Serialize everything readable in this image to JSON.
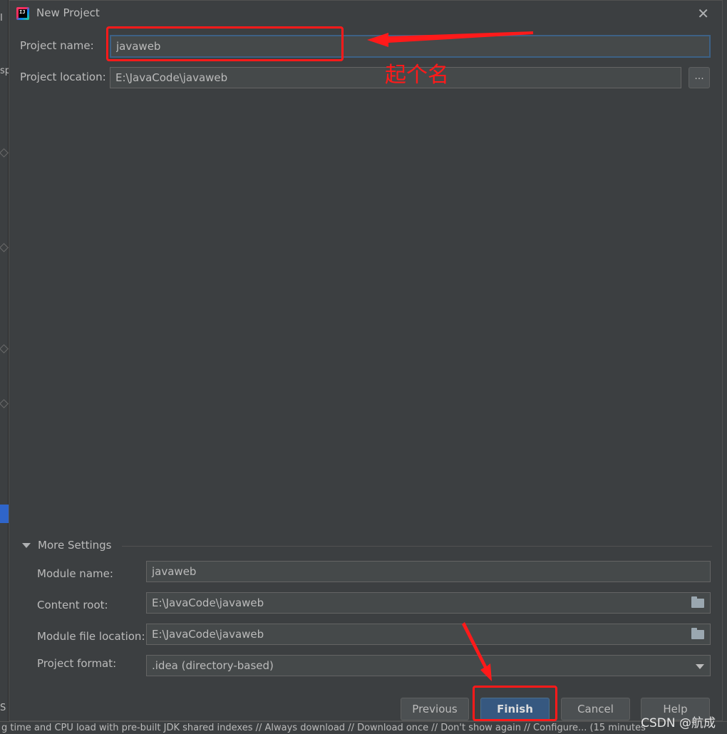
{
  "dialog": {
    "title": "New Project",
    "close_label": "✕",
    "project_name_label": "Project name:",
    "project_name_value": "javaweb",
    "project_location_label": "Project location:",
    "project_location_value": "E:\\JavaCode\\javaweb",
    "browse_label": "..."
  },
  "more_settings": {
    "label": "More Settings",
    "module_name_label": "Module name:",
    "module_name_value": "javaweb",
    "content_root_label": "Content root:",
    "content_root_value": "E:\\JavaCode\\javaweb",
    "module_file_location_label": "Module file location:",
    "module_file_location_value": "E:\\JavaCode\\javaweb",
    "project_format_label": "Project format:",
    "project_format_value": ".idea (directory-based)"
  },
  "buttons": {
    "previous": "Previous",
    "finish": "Finish",
    "cancel": "Cancel",
    "help": "Help"
  },
  "annotation": {
    "text": "起个名",
    "color": "#ff1a1a"
  },
  "background": {
    "status_text": "g time and CPU load with pre-built JDK shared indexes // Always download // Download once // Don't show again // Configure... (15 minutes",
    "left_fragment_1": "I",
    "left_fragment_2": "sp",
    "left_fragment_3": "S"
  },
  "watermark": "CSDN @航成",
  "colors": {
    "dialog_bg": "#3c3f41",
    "field_bg": "#45494a",
    "primary_button": "#365880",
    "focus_border": "#3d6185"
  }
}
